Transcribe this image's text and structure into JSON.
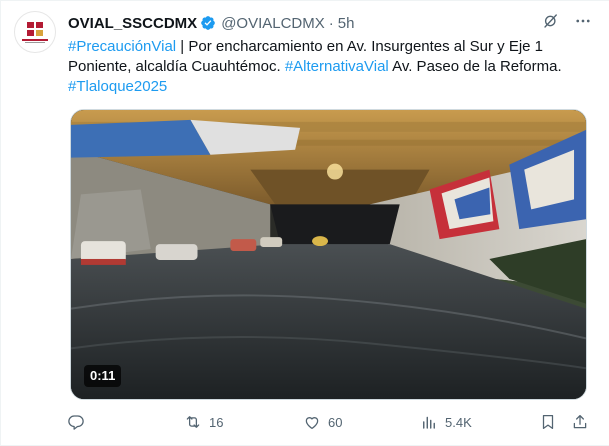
{
  "post": {
    "author_name": "OVIAL_SSCCDMX",
    "handle": "@OVIALCDMX",
    "separator": "·",
    "time_ago": "5h",
    "text_parts": [
      {
        "kind": "hashtag",
        "text": "#PrecauciónVial"
      },
      {
        "kind": "plain",
        "text": " | Por encharcamiento en Av. Insurgentes al Sur y Eje 1 Poniente, alcaldía Cuauhtémoc. "
      },
      {
        "kind": "hashtag",
        "text": "#AlternativaVial"
      },
      {
        "kind": "plain",
        "text": " Av. Paseo de la Reforma. "
      },
      {
        "kind": "hashtag",
        "text": "#Tlaloque2025"
      }
    ],
    "video_duration": "0:11"
  },
  "actions": {
    "reply_count": "",
    "repost_count": "16",
    "like_count": "60",
    "views_count": "5.4K"
  },
  "icons": {
    "verified": "verified-badge-icon",
    "grok": "grok-icon",
    "more": "more-icon",
    "reply": "reply-icon",
    "repost": "repost-icon",
    "like": "like-icon",
    "views": "views-icon",
    "bookmark": "bookmark-icon",
    "share": "share-icon"
  },
  "colors": {
    "accent": "#1d9bf0",
    "text": "#0f1419",
    "muted": "#536471",
    "avatar_brand": "#b31b34"
  }
}
